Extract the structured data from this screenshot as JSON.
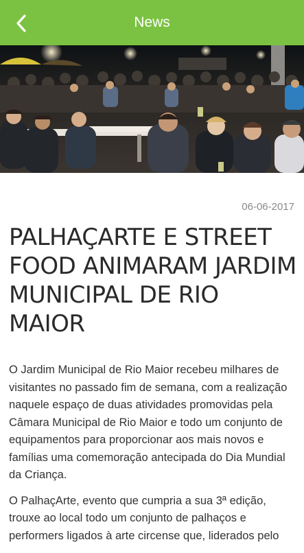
{
  "header": {
    "title": "News",
    "back_icon": "chevron-left-icon"
  },
  "colors": {
    "accent": "#7cc242",
    "header_text": "#ffffff",
    "date_text": "#8a8a8a"
  },
  "hero_image": {
    "icon": "event-photo"
  },
  "article": {
    "date": "06-06-2017",
    "title": "PALHAÇARTE E STREET FOOD ANIMARAM JARDIM MUNICIPAL DE RIO MAIOR",
    "paragraphs": [
      "O Jardim Municipal de Rio Maior recebeu milhares de visitantes no passado fim de semana, com a realização naquele espaço de duas atividades promovidas pela Câmara Municipal de Rio Maior e todo um conjunto de equipamentos para proporcionar aos mais novos e famílias uma comemoração antecipada do Dia Mundial da Criança.",
      "O PalhaçArte, evento que cumpria a sua 3ª edição, trouxe ao local todo um conjunto de palhaços e performers ligados à arte circense que, liderados pelo"
    ]
  }
}
